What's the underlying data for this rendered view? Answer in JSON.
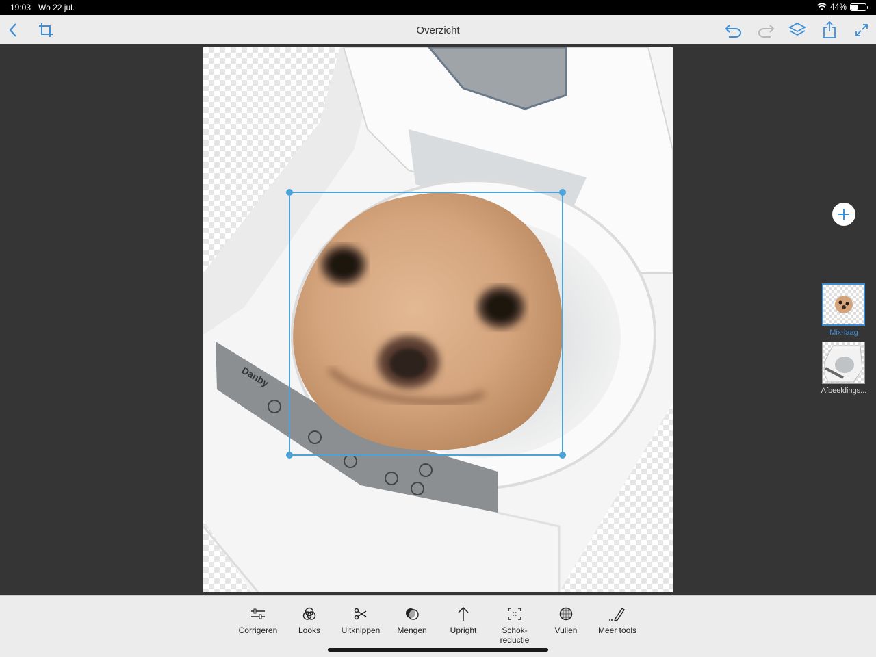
{
  "status_bar": {
    "time": "19:03",
    "date": "Wo 22 jul.",
    "battery": "44%",
    "battery_level": 0.44
  },
  "toolbar": {
    "title": "Overzicht"
  },
  "layers": [
    {
      "label": "Mix-laag",
      "active": true
    },
    {
      "label": "Afbeeldings...",
      "active": false
    }
  ],
  "canvas": {
    "brand_text": "Danby"
  },
  "tools": [
    {
      "label": "Corrigeren",
      "icon": "sliders-icon"
    },
    {
      "label": "Looks",
      "icon": "circles-icon"
    },
    {
      "label": "Uitknippen",
      "icon": "scissors-icon"
    },
    {
      "label": "Mengen",
      "icon": "blend-icon"
    },
    {
      "label": "Upright",
      "icon": "upright-arrow-icon"
    },
    {
      "label": "Schok-\nreductie",
      "icon": "shake-reduction-icon"
    },
    {
      "label": "Vullen",
      "icon": "fill-globe-icon"
    },
    {
      "label": "Meer tools",
      "icon": "pencil-icon"
    }
  ],
  "colors": {
    "accent": "#3b8fd9",
    "workspace": "#353535",
    "bar": "#ececec"
  }
}
